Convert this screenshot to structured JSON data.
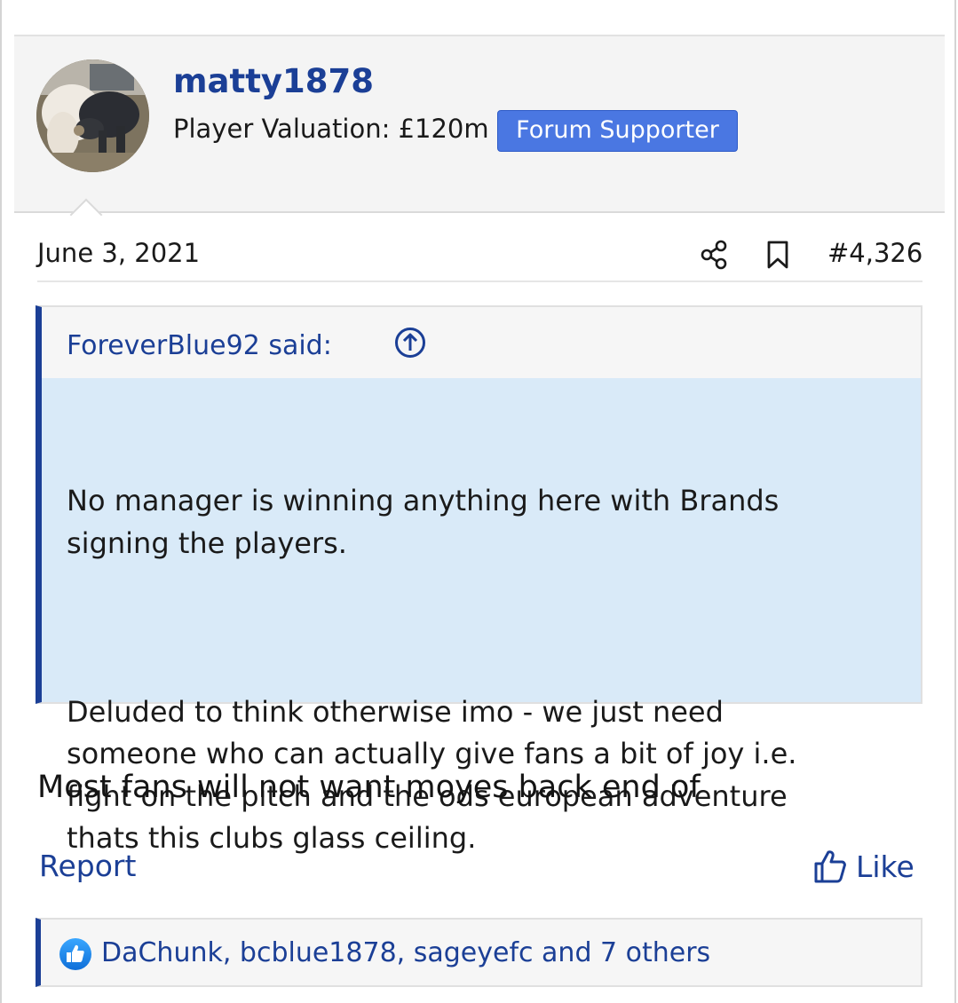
{
  "user": {
    "username": "matty1878",
    "valuation": "Player Valuation: £120m",
    "badge": "Forum Supporter"
  },
  "post": {
    "date": "June 3, 2021",
    "number": "#4,326",
    "body": "Most fans will not want moyes back end of"
  },
  "quote": {
    "author": "ForeverBlue92 said:",
    "paragraphs": [
      "No manager is winning anything here with Brands\nsigning the players.",
      "Deluded to think otherwise imo - we just need\nsomeone who can actually give fans a bit of joy i.e.\nfight on the pitch and the ods european adventure\nthats this clubs glass ceiling."
    ]
  },
  "actions": {
    "report": "Report",
    "like": "Like"
  },
  "reactions": {
    "text": "DaChunk, bcblue1878, sageyefc and 7 others"
  },
  "icons": {
    "share": "share-icon",
    "bookmark": "bookmark-icon",
    "quote_link": "arrow-up-circle-icon",
    "like": "thumbs-up-icon",
    "reaction": "like-reaction-icon"
  },
  "colors": {
    "accent": "#1b3f96",
    "badge": "#4a77e2",
    "quote_bg": "#d9eaf8"
  }
}
